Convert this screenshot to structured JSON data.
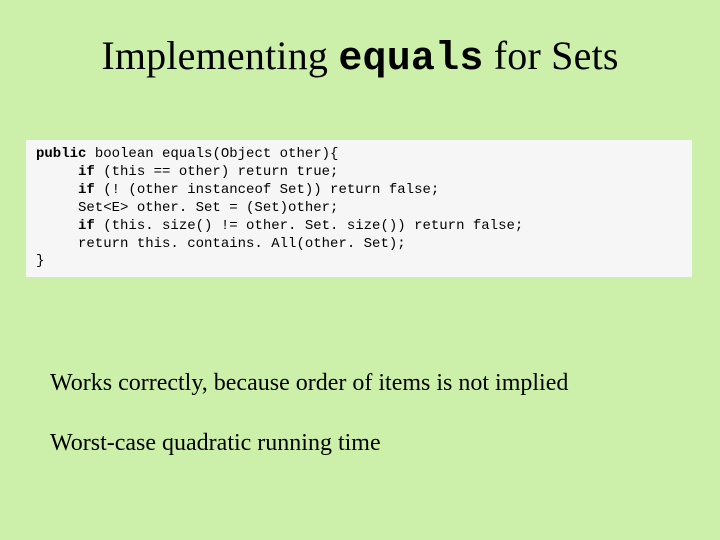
{
  "title": {
    "part1": "Implementing ",
    "code": "equals",
    "part2": " for Sets"
  },
  "code": {
    "l1a": "public",
    "l1b": " boolean equals(Object other){",
    "l2a": "     if",
    "l2b": " (this == other) return true;",
    "l3a": "     if",
    "l3b": " (! (other instanceof Set)) return false;",
    "l4": "     Set<E> other. Set = (Set)other;",
    "l5a": "     if",
    "l5b": " (this. size() != other. Set. size()) return false;",
    "l6": "     return this. contains. All(other. Set);",
    "l7": "}"
  },
  "body": {
    "line1": "Works correctly, because order of items is not implied",
    "line2": "Worst-case quadratic running time"
  }
}
